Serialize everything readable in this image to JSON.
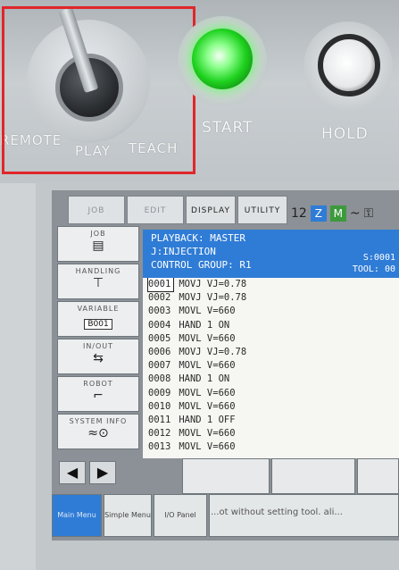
{
  "panel": {
    "mode_labels": [
      "REMOTE",
      "PLAY",
      "TEACH"
    ],
    "start_label": "START",
    "hold_label": "HOLD",
    "colors": {
      "start_lamp": "#1fd21f",
      "highlight_box": "#e0262a"
    }
  },
  "menu_tabs": [
    "JOB",
    "EDIT",
    "DISPLAY",
    "UTILITY"
  ],
  "status_icons": [
    "12",
    "Z",
    "M",
    "~",
    "key-icon"
  ],
  "side_menu": [
    {
      "label": "JOB",
      "icon": "job-icon"
    },
    {
      "label": "HANDLING",
      "icon": "handling-icon"
    },
    {
      "label": "VARIABLE",
      "icon": "B001"
    },
    {
      "label": "IN/OUT",
      "icon": "in-out-icon"
    },
    {
      "label": "ROBOT",
      "icon": "robot-icon"
    },
    {
      "label": "SYSTEM INFO",
      "icon": "system-info-icon"
    }
  ],
  "job": {
    "title": "PLAYBACK: MASTER",
    "job_name": "J:INJECTION",
    "control_group": "CONTROL GROUP: R1",
    "step": "S:0001",
    "tool": "TOOL: 00",
    "lines": [
      {
        "no": "0001",
        "cmd": "MOVJ VJ=0.78"
      },
      {
        "no": "0002",
        "cmd": "MOVJ VJ=0.78"
      },
      {
        "no": "0003",
        "cmd": "MOVL V=660"
      },
      {
        "no": "0004",
        "cmd": "HAND 1 ON"
      },
      {
        "no": "0005",
        "cmd": "MOVL V=660"
      },
      {
        "no": "0006",
        "cmd": "MOVJ VJ=0.78"
      },
      {
        "no": "0007",
        "cmd": "MOVL V=660"
      },
      {
        "no": "0008",
        "cmd": "HAND 1 ON"
      },
      {
        "no": "0009",
        "cmd": "MOVL V=660"
      },
      {
        "no": "0010",
        "cmd": "MOVL V=660"
      },
      {
        "no": "0011",
        "cmd": "HAND 1 OFF"
      },
      {
        "no": "0012",
        "cmd": "MOVL V=660"
      },
      {
        "no": "0013",
        "cmd": "MOVL V=660"
      }
    ]
  },
  "footer": {
    "main_menu": "Main Menu",
    "simple_menu": "Simple Menu",
    "io_panel": "I/O Panel",
    "hint": "...ot without setting tool. ali..."
  },
  "nav": {
    "back": "◀",
    "forward": "▶"
  }
}
